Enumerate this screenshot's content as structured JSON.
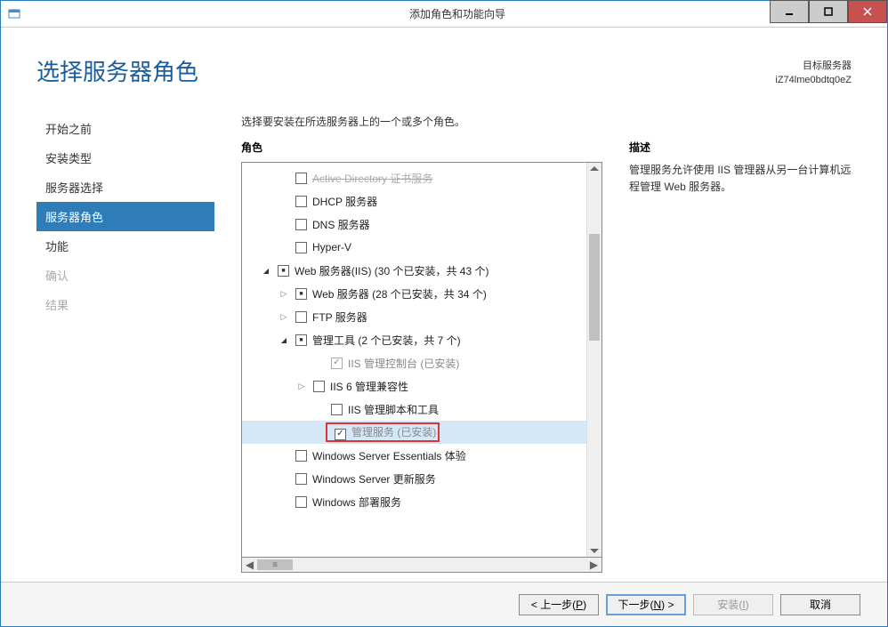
{
  "window": {
    "title": "添加角色和功能向导"
  },
  "header": {
    "page_title": "选择服务器角色",
    "target_label": "目标服务器",
    "target_name": "iZ74lme0bdtq0eZ"
  },
  "sidebar": {
    "items": [
      {
        "label": "开始之前",
        "state": "normal"
      },
      {
        "label": "安装类型",
        "state": "normal"
      },
      {
        "label": "服务器选择",
        "state": "normal"
      },
      {
        "label": "服务器角色",
        "state": "active"
      },
      {
        "label": "功能",
        "state": "normal"
      },
      {
        "label": "确认",
        "state": "disabled"
      },
      {
        "label": "结果",
        "state": "disabled"
      }
    ]
  },
  "main": {
    "instruction": "选择要安装在所选服务器上的一个或多个角色。",
    "roles_label": "角色",
    "desc_label": "描述",
    "description": "管理服务允许使用 IIS 管理器从另一台计算机远程管理 Web 服务器。"
  },
  "tree": {
    "rows": [
      {
        "indent": 2,
        "chev": "",
        "check": "empty",
        "label": "Active Directory 证书服务",
        "cut": true
      },
      {
        "indent": 2,
        "chev": "",
        "check": "empty",
        "label": "DHCP 服务器"
      },
      {
        "indent": 2,
        "chev": "",
        "check": "empty",
        "label": "DNS 服务器"
      },
      {
        "indent": 2,
        "chev": "",
        "check": "empty",
        "label": "Hyper-V"
      },
      {
        "indent": 1,
        "chev": "open",
        "check": "partial",
        "label": "Web 服务器(IIS) (30 个已安装，共 43 个)"
      },
      {
        "indent": 2,
        "chev": "closed",
        "check": "partial",
        "label": "Web 服务器 (28 个已安装，共 34 个)"
      },
      {
        "indent": 2,
        "chev": "closed",
        "check": "empty",
        "label": "FTP 服务器"
      },
      {
        "indent": 2,
        "chev": "open",
        "check": "partial",
        "label": "管理工具 (2 个已安装，共 7 个)"
      },
      {
        "indent": 4,
        "chev": "",
        "check": "checked-disabled",
        "label": "IIS 管理控制台 (已安装)",
        "disabled": true
      },
      {
        "indent": 3,
        "chev": "closed",
        "check": "empty",
        "label": "IIS 6 管理兼容性"
      },
      {
        "indent": 4,
        "chev": "",
        "check": "empty",
        "label": "IIS 管理脚本和工具"
      },
      {
        "indent": 4,
        "chev": "",
        "check": "checked",
        "label": "管理服务 (已安装)",
        "selected": true,
        "highlight": true
      },
      {
        "indent": 2,
        "chev": "",
        "check": "empty",
        "label": "Windows Server Essentials 体验"
      },
      {
        "indent": 2,
        "chev": "",
        "check": "empty",
        "label": "Windows Server 更新服务"
      },
      {
        "indent": 2,
        "chev": "",
        "check": "empty",
        "label": "Windows 部署服务"
      }
    ]
  },
  "footer": {
    "prev_prefix": "< 上一步(",
    "prev_key": "P",
    "prev_suffix": ")",
    "next_prefix": "下一步(",
    "next_key": "N",
    "next_suffix": ") >",
    "install_prefix": "安装(",
    "install_key": "I",
    "install_suffix": ")",
    "cancel": "取消"
  }
}
